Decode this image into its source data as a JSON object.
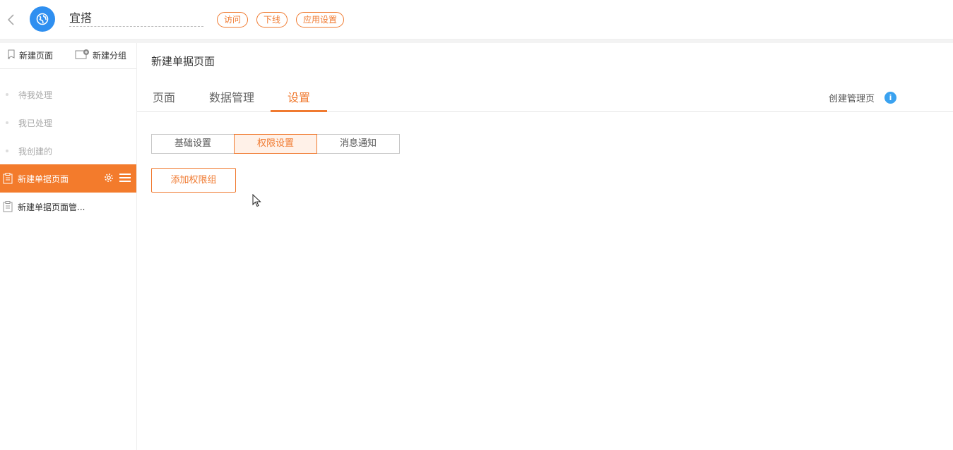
{
  "header": {
    "app_name": "宜搭",
    "pills": [
      "访问",
      "下线",
      "应用设置"
    ]
  },
  "sidebar": {
    "actions": {
      "new_page": "新建页面",
      "new_group": "新建分组"
    },
    "items": [
      {
        "label": "待我处理",
        "type": "muted"
      },
      {
        "label": "我已处理",
        "type": "muted"
      },
      {
        "label": "我创建的",
        "type": "muted"
      },
      {
        "label": "新建单据页面",
        "type": "active"
      },
      {
        "label": "新建单据页面管...",
        "type": "page"
      }
    ]
  },
  "main": {
    "title": "新建单据页面",
    "tabs": [
      "页面",
      "数据管理",
      "设置"
    ],
    "active_tab": "设置",
    "create_manage_page": "创建管理页",
    "segments": [
      "基础设置",
      "权限设置",
      "消息通知"
    ],
    "active_segment": "权限设置",
    "add_permission_group": "添加权限组"
  },
  "colors": {
    "accent": "#f07a30",
    "sidebar_active": "#f37b2c",
    "logo": "#2f8ff0",
    "info": "#3aa2f0"
  },
  "icons": [
    "back-icon",
    "app-logo-icon",
    "new-page-icon",
    "new-group-icon",
    "doc-icon",
    "gear-icon",
    "menu-icon",
    "info-icon",
    "cursor-icon"
  ]
}
